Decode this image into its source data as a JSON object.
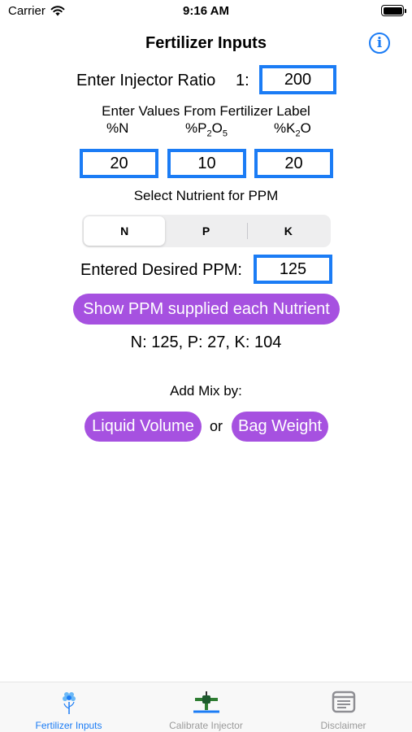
{
  "status_bar": {
    "carrier": "Carrier",
    "time": "9:16 AM"
  },
  "nav": {
    "title": "Fertilizer Inputs",
    "info_icon": "info-icon"
  },
  "injector": {
    "label": "Enter Injector Ratio",
    "prefix": "1:",
    "value": "200"
  },
  "fertilizer_label": {
    "heading": "Enter Values From Fertilizer Label",
    "n_label": "%N",
    "p_label_main": "%P",
    "p_sub1": "2",
    "p_mid": "O",
    "p_sub2": "5",
    "k_label_main": "%K",
    "k_sub": "2",
    "k_end": "O",
    "n_value": "20",
    "p_value": "10",
    "k_value": "20"
  },
  "nutrient_select": {
    "label": "Select Nutrient for PPM",
    "options": [
      "N",
      "P",
      "K"
    ],
    "selected": "N"
  },
  "ppm": {
    "label": "Entered Desired PPM:",
    "value": "125"
  },
  "show_button": "Show PPM supplied each Nutrient",
  "result": "N: 125, P: 27, K: 104",
  "add_mix": {
    "label": "Add Mix by:",
    "liquid": "Liquid Volume",
    "or": "or",
    "bag": "Bag Weight"
  },
  "tabs": [
    {
      "label": "Fertilizer Inputs",
      "icon": "flower-icon",
      "active": true
    },
    {
      "label": "Calibrate Injector",
      "icon": "injector-icon",
      "active": false
    },
    {
      "label": "Disclaimer",
      "icon": "document-icon",
      "active": false
    }
  ],
  "colors": {
    "accent": "#1b7cf5",
    "button": "#a651e0",
    "inactive": "#9a9a9a"
  }
}
